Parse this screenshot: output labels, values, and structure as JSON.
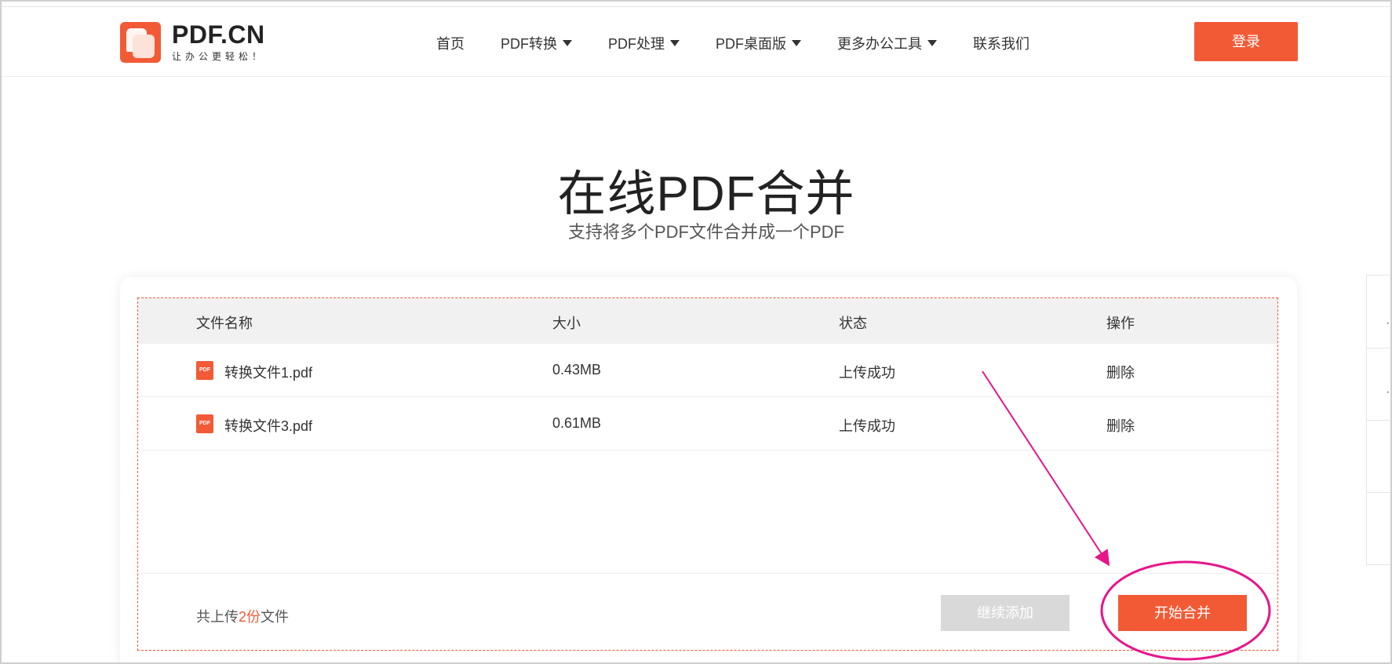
{
  "header": {
    "logo_title": "PDF.CN",
    "logo_slogan": "让办公更轻松！",
    "nav": [
      {
        "label": "首页",
        "has_dropdown": false
      },
      {
        "label": "PDF转换",
        "has_dropdown": true
      },
      {
        "label": "PDF处理",
        "has_dropdown": true
      },
      {
        "label": "PDF桌面版",
        "has_dropdown": true
      },
      {
        "label": "更多办公工具",
        "has_dropdown": true
      },
      {
        "label": "联系我们",
        "has_dropdown": false
      }
    ],
    "login_label": "登录"
  },
  "hero": {
    "title": "在线PDF合并",
    "subtitle": "支持将多个PDF文件合并成一个PDF"
  },
  "table": {
    "columns": [
      "文件名称",
      "大小",
      "状态",
      "操作"
    ],
    "rows": [
      {
        "icon_text": "PDF",
        "name": "转换文件1.pdf",
        "size": "0.43MB",
        "status": "上传成功",
        "action": "删除"
      },
      {
        "icon_text": "PDF",
        "name": "转换文件3.pdf",
        "size": "0.61MB",
        "status": "上传成功",
        "action": "删除"
      }
    ]
  },
  "footer": {
    "count_prefix": "共上传",
    "count_value": "2份",
    "count_suffix": "文件",
    "add_more_label": "继续添加",
    "merge_label": "开始合并"
  },
  "colors": {
    "brand": "#f25a36",
    "annotation": "#e6168a",
    "disabled_button": "#d9d9d9"
  },
  "icons": [
    "logo-icon",
    "pdf-file-icon",
    "caret-down-icon"
  ]
}
